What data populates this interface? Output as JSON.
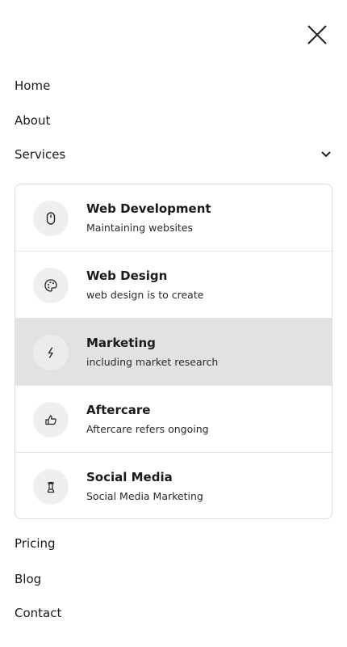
{
  "menu": {
    "close_icon": "close-icon",
    "items": [
      {
        "label": "Home"
      },
      {
        "label": "About"
      },
      {
        "label": "Services",
        "expanded": true,
        "icon": "chevron-down-icon"
      }
    ],
    "services": [
      {
        "title": "Web Development",
        "subtitle": "Maintaining websites",
        "icon": "mouse-icon"
      },
      {
        "title": "Web Design",
        "subtitle": "web design is to create",
        "icon": "palette-icon"
      },
      {
        "title": "Marketing",
        "subtitle": "including market research",
        "icon": "lightning-icon",
        "active": true
      },
      {
        "title": "Aftercare",
        "subtitle": "Aftercare refers ongoing",
        "icon": "thumbs-up-icon"
      },
      {
        "title": "Social Media",
        "subtitle": "Social Media Marketing",
        "icon": "chess-rook-icon"
      }
    ],
    "bottom_items": [
      {
        "label": "Pricing"
      },
      {
        "label": "Blog"
      },
      {
        "label": "Contact"
      }
    ]
  },
  "colors": {
    "text": "#1a1a1a",
    "active_bg": "#e2e2e2",
    "icon_bg": "#efefef",
    "border": "#dcdcdc"
  }
}
